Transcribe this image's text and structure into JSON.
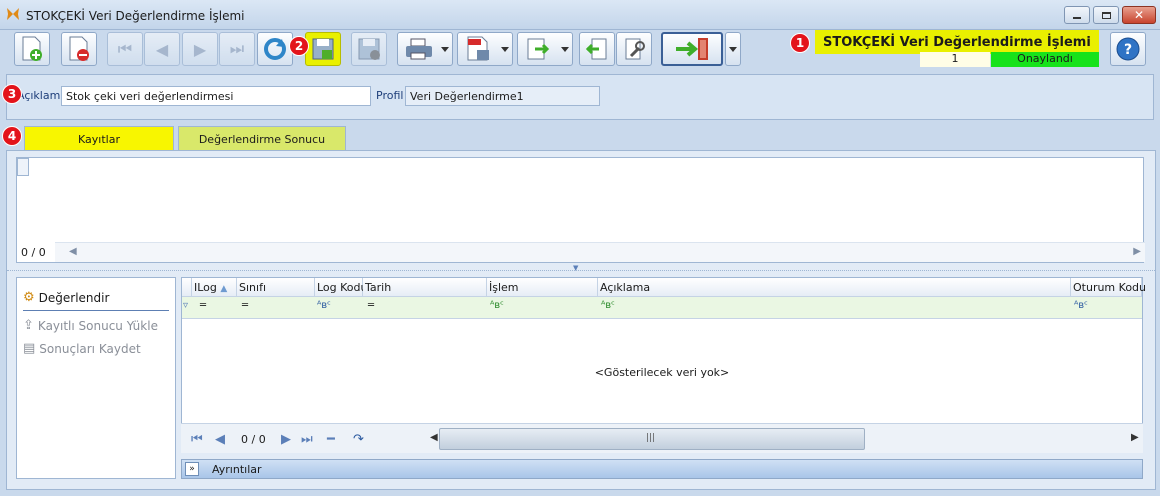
{
  "window": {
    "title": "STOKÇEKİ Veri Değerlendirme İşlemi"
  },
  "header": {
    "title": "STOKÇEKİ Veri Değerlendirme İşlemi",
    "number": "1",
    "status": "Onaylandı"
  },
  "badges": {
    "b1": "1",
    "b2": "2",
    "b3": "3",
    "b4": "4"
  },
  "form": {
    "desc_label": "Açıklama",
    "desc_value": "Stok çeki veri değerlendirmesi",
    "profile_label": "Profil",
    "profile_value": "Veri Değerlendirme1"
  },
  "tabs": [
    {
      "label": "Kayıtlar"
    },
    {
      "label": "Değerlendirme Sonucu"
    }
  ],
  "grid1": {
    "counter": "0 / 0"
  },
  "actions": [
    {
      "label": "Değerlendir"
    },
    {
      "label": "Kayıtlı Sonucu Yükle"
    },
    {
      "label": "Sonuçları Kaydet"
    }
  ],
  "grid2": {
    "columns": [
      "ILog",
      "Sınıfı",
      "Log Kodu",
      "Tarih",
      "İşlem",
      "Açıklama",
      "Oturum Kodu"
    ],
    "empty_text": "<Gösterilecek veri yok>",
    "counter": "0 / 0"
  },
  "details": {
    "label": "Ayrıntılar"
  },
  "colors": {
    "highlight": "#e9f000",
    "status_green": "#17e21b",
    "badge_red": "#e3141b"
  }
}
